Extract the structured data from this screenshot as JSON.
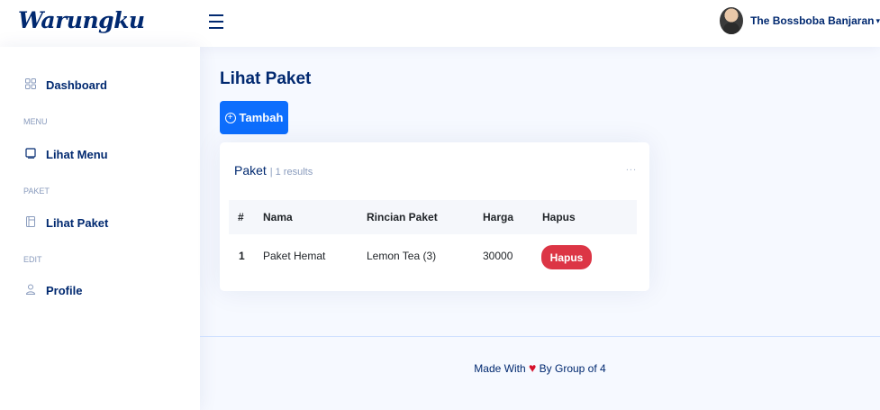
{
  "header": {
    "logo": "Warungku",
    "user_name": "The Bossboba Banjaran",
    "caret": "▾"
  },
  "sidebar": {
    "items": [
      {
        "label": "Dashboard",
        "icon": "grid-icon"
      },
      {
        "heading": "MENU"
      },
      {
        "label": "Lihat Menu",
        "icon": "menu-book-icon"
      },
      {
        "heading": "PAKET"
      },
      {
        "label": "Lihat Paket",
        "icon": "layout-icon"
      },
      {
        "heading": "EDIT"
      },
      {
        "label": "Profile",
        "icon": "person-icon"
      }
    ]
  },
  "main": {
    "title": "Lihat Paket",
    "add_button": "Tambah",
    "card": {
      "title": "Paket",
      "subtitle": "| 1 results",
      "dots": "...",
      "columns": [
        "#",
        "Nama",
        "Rincian Paket",
        "Harga",
        "Hapus"
      ],
      "rows": [
        {
          "no": "1",
          "nama": "Paket Hemat",
          "rincian": "Lemon Tea (3)",
          "harga": "30000",
          "hapus": "Hapus"
        }
      ]
    }
  },
  "footer": {
    "text_before": "Made With",
    "heart": "♥",
    "text_after": "By Group of 4"
  },
  "colors": {
    "primary": "#0d6efd",
    "danger": "#dc3545",
    "navy": "#012970",
    "background": "#f6f9ff"
  }
}
